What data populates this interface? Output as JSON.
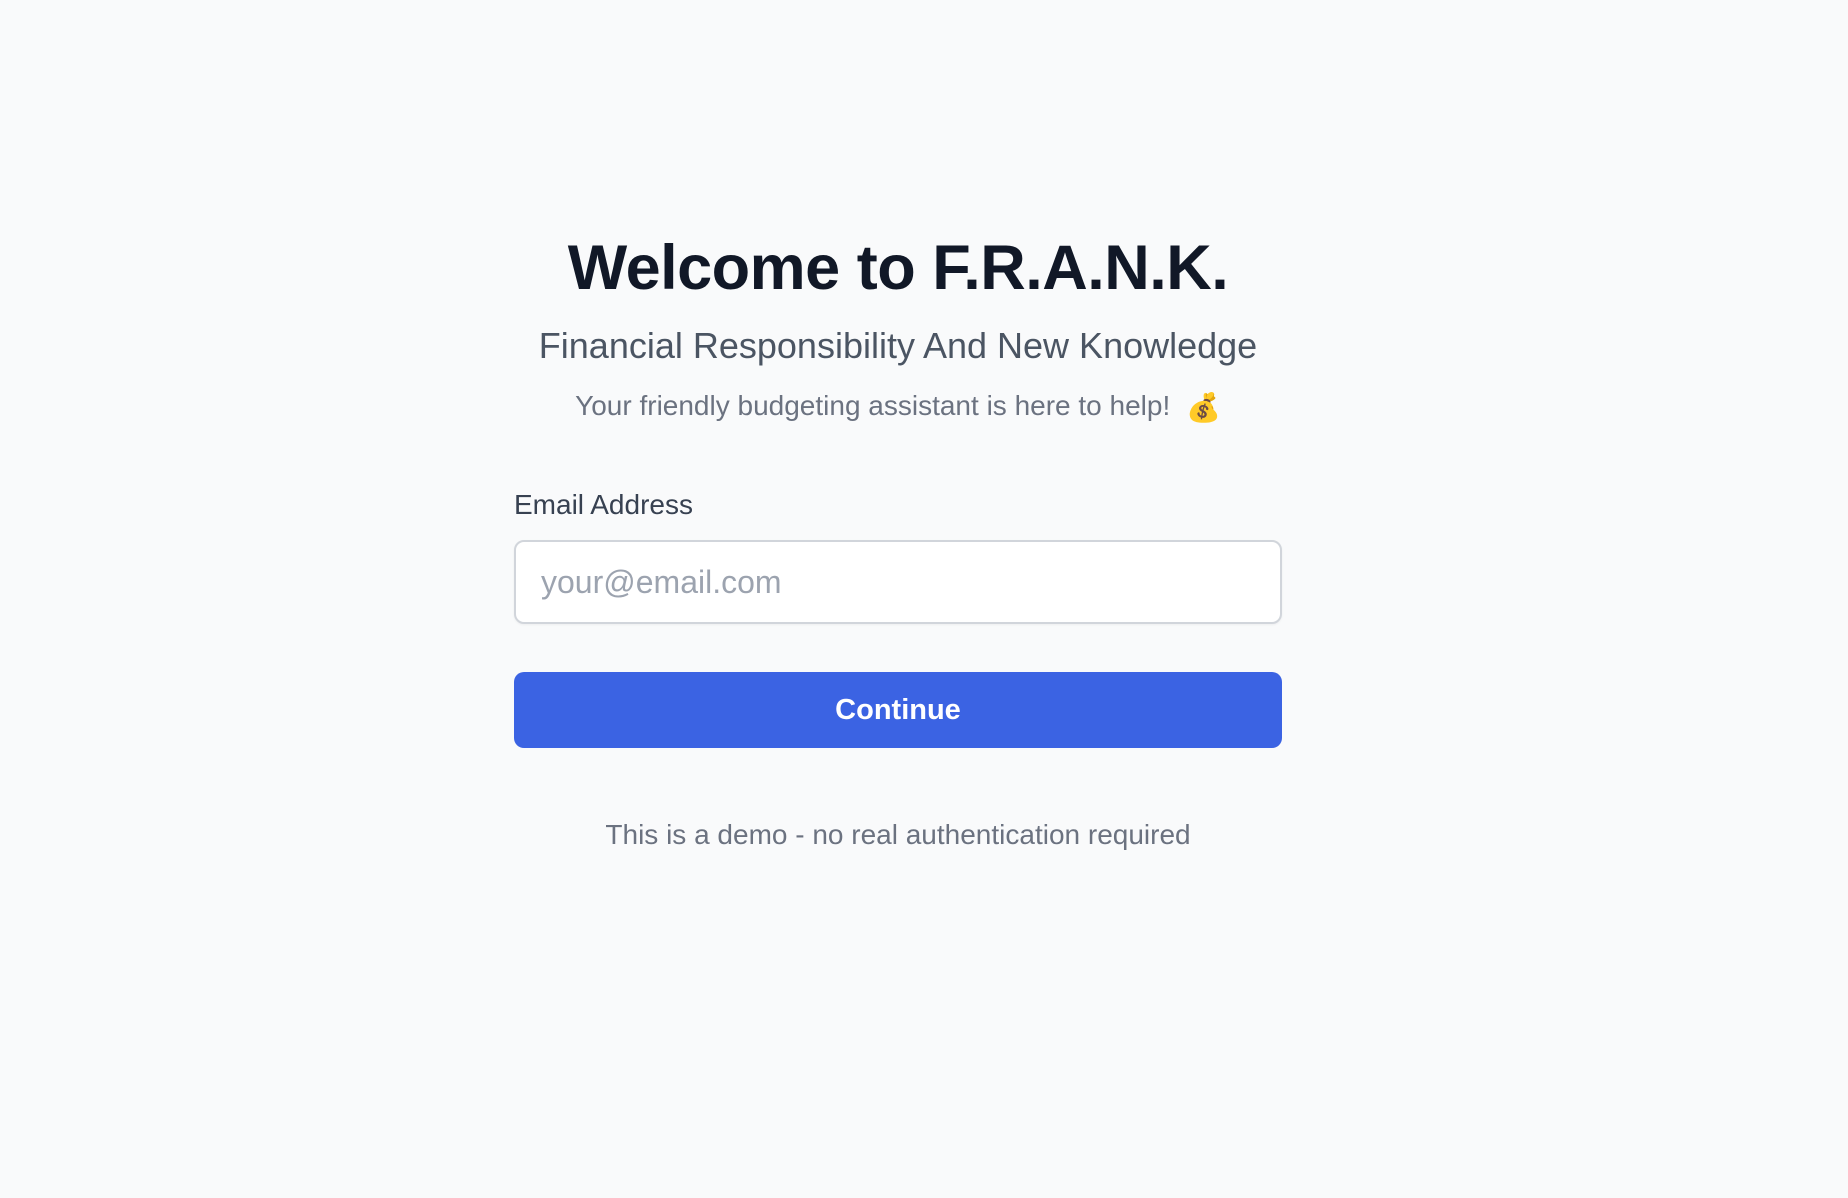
{
  "header": {
    "title": "Welcome to F.R.A.N.K.",
    "subtitle": "Financial Responsibility And New Knowledge",
    "tagline": "Your friendly budgeting assistant is here to help!",
    "tagline_emoji": "💰"
  },
  "form": {
    "email_label": "Email Address",
    "email_placeholder": "your@email.com",
    "email_value": "",
    "submit_label": "Continue"
  },
  "footer": {
    "demo_note": "This is a demo - no real authentication required"
  },
  "colors": {
    "background": "#f9fafb",
    "primary_button": "#3b63e3",
    "title": "#111827",
    "subtitle": "#4b5563",
    "muted_text": "#6b7280"
  }
}
